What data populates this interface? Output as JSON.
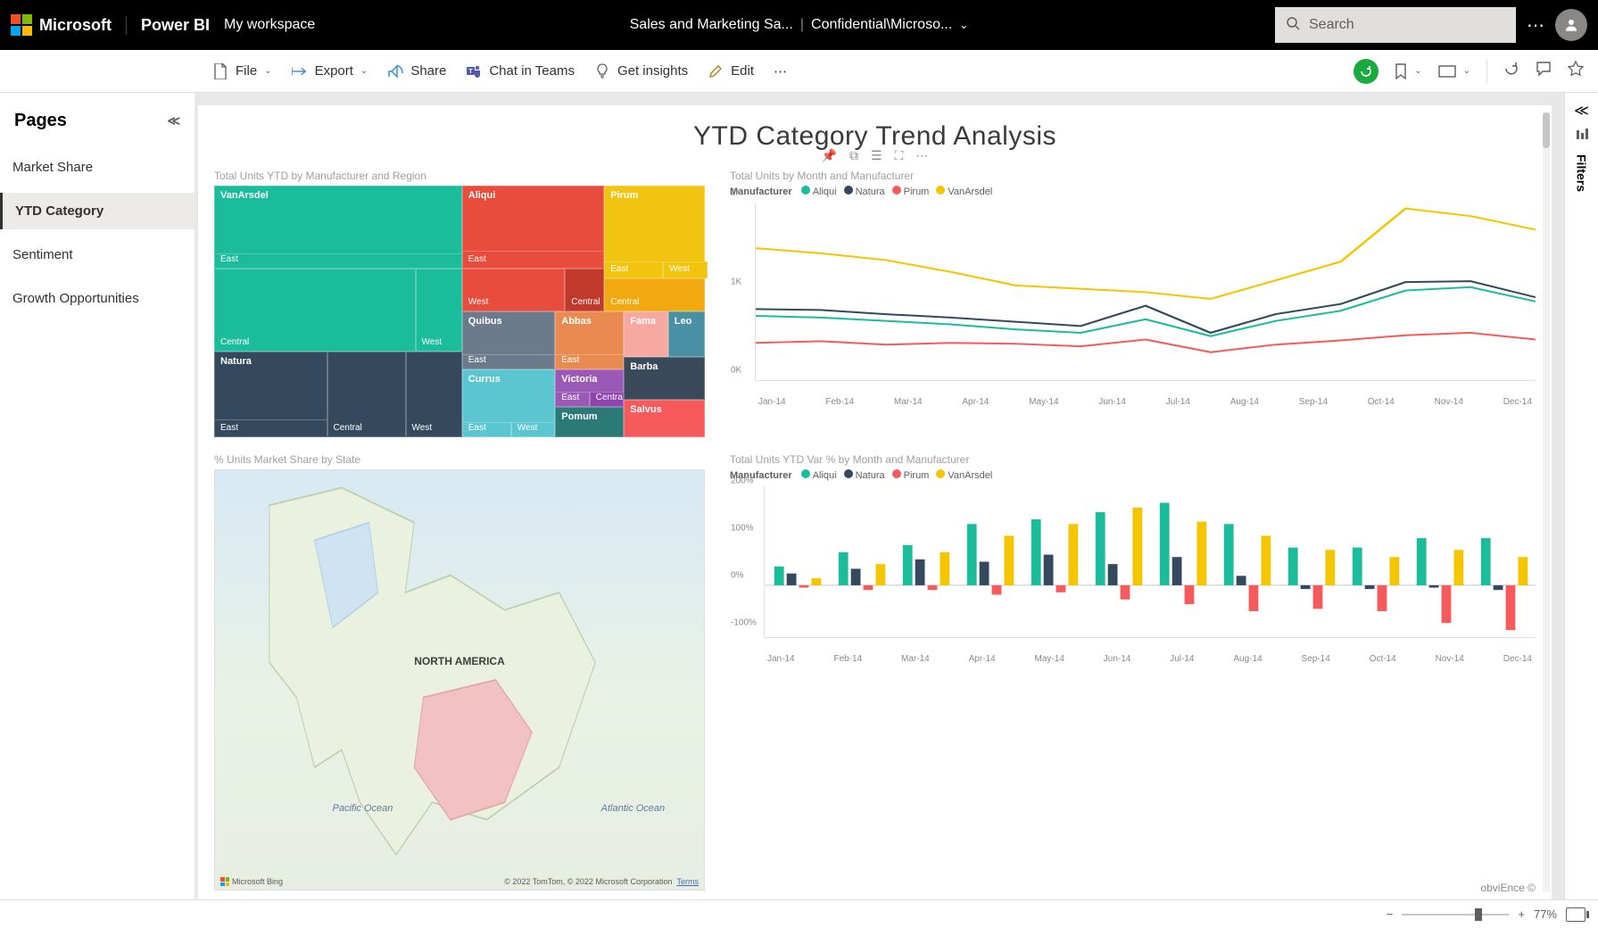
{
  "header": {
    "microsoft": "Microsoft",
    "product": "Power BI",
    "workspace": "My workspace",
    "report_name": "Sales and Marketing Sa...",
    "sensitivity": "Confidential\\Microso...",
    "search_placeholder": "Search"
  },
  "toolbar": {
    "file": "File",
    "export": "Export",
    "share": "Share",
    "chat": "Chat in Teams",
    "insights": "Get insights",
    "edit": "Edit"
  },
  "sidebar": {
    "title": "Pages",
    "items": [
      {
        "label": "Market Share",
        "active": false
      },
      {
        "label": "YTD Category",
        "active": true
      },
      {
        "label": "Sentiment",
        "active": false
      },
      {
        "label": "Growth Opportunities",
        "active": false
      }
    ]
  },
  "report": {
    "title": "YTD Category Trend Analysis",
    "credit": "obviEnce ©"
  },
  "filters": {
    "label": "Filters"
  },
  "footer": {
    "zoom": "77%"
  },
  "tiles": {
    "treemap": {
      "title": "Total Units YTD by Manufacturer and Region"
    },
    "line": {
      "title": "Total Units by Month and Manufacturer",
      "legend_label": "Manufacturer"
    },
    "map": {
      "title": "% Units Market Share by State",
      "na_label": "NORTH AMERICA",
      "pacific": "Pacific Ocean",
      "atlantic": "Atlantic Ocean",
      "bing": "Microsoft Bing",
      "copyright": "© 2022 TomTom, © 2022 Microsoft Corporation",
      "terms": "Terms"
    },
    "bar": {
      "title": "Total Units YTD Var % by Month and Manufacturer",
      "legend_label": "Manufacturer"
    }
  },
  "colors": {
    "Aliqui": "#1bbc9b",
    "Natura": "#34495e",
    "Pirum": "#f65a5b",
    "VanArsdel": "#f5c500"
  },
  "chart_data": [
    {
      "id": "treemap",
      "type": "treemap",
      "title": "Total Units YTD by Manufacturer and Region",
      "nodes": [
        {
          "manufacturer": "VanArsdel",
          "region": "East",
          "value": 2800,
          "color": "#1bbc9b"
        },
        {
          "manufacturer": "VanArsdel",
          "region": "Central",
          "value": 1800,
          "color": "#1bbc9b"
        },
        {
          "manufacturer": "VanArsdel",
          "region": "West",
          "value": 700,
          "color": "#1bbc9b"
        },
        {
          "manufacturer": "Natura",
          "region": "East",
          "value": 1000,
          "color": "#34495e"
        },
        {
          "manufacturer": "Natura",
          "region": "Central",
          "value": 700,
          "color": "#34495e"
        },
        {
          "manufacturer": "Natura",
          "region": "West",
          "value": 550,
          "color": "#34495e"
        },
        {
          "manufacturer": "Aliqui",
          "region": "East",
          "value": 1100,
          "color": "#e74c3c"
        },
        {
          "manufacturer": "Aliqui",
          "region": "West",
          "value": 650,
          "color": "#e74c3c"
        },
        {
          "manufacturer": "Aliqui",
          "region": "Central",
          "value": 300,
          "color": "#e74c3c"
        },
        {
          "manufacturer": "Pirum",
          "region": "East",
          "value": 700,
          "color": "#f1c40f"
        },
        {
          "manufacturer": "Pirum",
          "region": "West",
          "value": 300,
          "color": "#f1c40f"
        },
        {
          "manufacturer": "Pirum",
          "region": "Central",
          "value": 300,
          "color": "#f1c40f"
        },
        {
          "manufacturer": "Quibus",
          "region": "East",
          "value": 500,
          "color": "#6b7b8c"
        },
        {
          "manufacturer": "Abbas",
          "region": "East",
          "value": 350,
          "color": "#e98b50"
        },
        {
          "manufacturer": "Currus",
          "region": "East",
          "value": 300,
          "color": "#5bc6d0"
        },
        {
          "manufacturer": "Currus",
          "region": "West",
          "value": 180,
          "color": "#5bc6d0"
        },
        {
          "manufacturer": "Victoria",
          "region": "East",
          "value": 160,
          "color": "#9b59b6"
        },
        {
          "manufacturer": "Victoria",
          "region": "Central",
          "value": 120,
          "color": "#9b59b6"
        },
        {
          "manufacturer": "Pomum",
          "region": "",
          "value": 220,
          "color": "#2b7a78"
        },
        {
          "manufacturer": "Fama",
          "region": "",
          "value": 180,
          "color": "#f7a8a0"
        },
        {
          "manufacturer": "Leo",
          "region": "",
          "value": 140,
          "color": "#4a90a4"
        },
        {
          "manufacturer": "Barba",
          "region": "",
          "value": 180,
          "color": "#3b4a5a"
        },
        {
          "manufacturer": "Salvus",
          "region": "",
          "value": 150,
          "color": "#f65a5b"
        }
      ]
    },
    {
      "id": "line",
      "type": "line",
      "title": "Total Units by Month and Manufacturer",
      "xlabel": "",
      "ylabel": "",
      "ylim": [
        0,
        2100
      ],
      "categories": [
        "Jan-14",
        "Feb-14",
        "Mar-14",
        "Apr-14",
        "May-14",
        "Jun-14",
        "Jul-14",
        "Aug-14",
        "Sep-14",
        "Oct-14",
        "Nov-14",
        "Dec-14"
      ],
      "series": [
        {
          "name": "Aliqui",
          "color": "#1bbc9b",
          "values": [
            760,
            740,
            700,
            660,
            600,
            560,
            720,
            520,
            700,
            820,
            1060,
            1100,
            930
          ]
        },
        {
          "name": "Natura",
          "color": "#34495e",
          "values": [
            840,
            830,
            780,
            740,
            690,
            640,
            880,
            560,
            780,
            900,
            1160,
            1170,
            980
          ]
        },
        {
          "name": "Pirum",
          "color": "#f65a5b",
          "values": [
            440,
            460,
            420,
            440,
            430,
            400,
            480,
            330,
            420,
            470,
            530,
            560,
            480
          ]
        },
        {
          "name": "VanArsdel",
          "color": "#f5c500",
          "values": [
            1560,
            1500,
            1420,
            1280,
            1120,
            1080,
            1040,
            960,
            1180,
            1400,
            2030,
            1940,
            1780
          ]
        }
      ]
    },
    {
      "id": "bar",
      "type": "bar",
      "title": "Total Units YTD Var % by Month and Manufacturer",
      "xlabel": "",
      "ylabel": "",
      "ylim": [
        -110,
        210
      ],
      "categories": [
        "Jan-14",
        "Feb-14",
        "Mar-14",
        "Apr-14",
        "May-14",
        "Jun-14",
        "Jul-14",
        "Aug-14",
        "Sep-14",
        "Oct-14",
        "Nov-14",
        "Dec-14"
      ],
      "series": [
        {
          "name": "Aliqui",
          "color": "#1bbc9b",
          "values": [
            40,
            70,
            85,
            130,
            140,
            155,
            175,
            130,
            80,
            80,
            100,
            100
          ]
        },
        {
          "name": "Natura",
          "color": "#34495e",
          "values": [
            25,
            35,
            55,
            50,
            65,
            45,
            60,
            20,
            -8,
            -8,
            -5,
            -10
          ]
        },
        {
          "name": "Pirum",
          "color": "#f65a5b",
          "values": [
            -5,
            -10,
            -10,
            -20,
            -15,
            -30,
            -40,
            -55,
            -50,
            -55,
            -80,
            -95
          ]
        },
        {
          "name": "VanArsdel",
          "color": "#f5c500",
          "values": [
            15,
            45,
            70,
            105,
            130,
            165,
            135,
            105,
            75,
            60,
            75,
            60
          ]
        }
      ]
    },
    {
      "id": "map",
      "type": "map",
      "title": "% Units Market Share by State",
      "region": "North America"
    }
  ]
}
